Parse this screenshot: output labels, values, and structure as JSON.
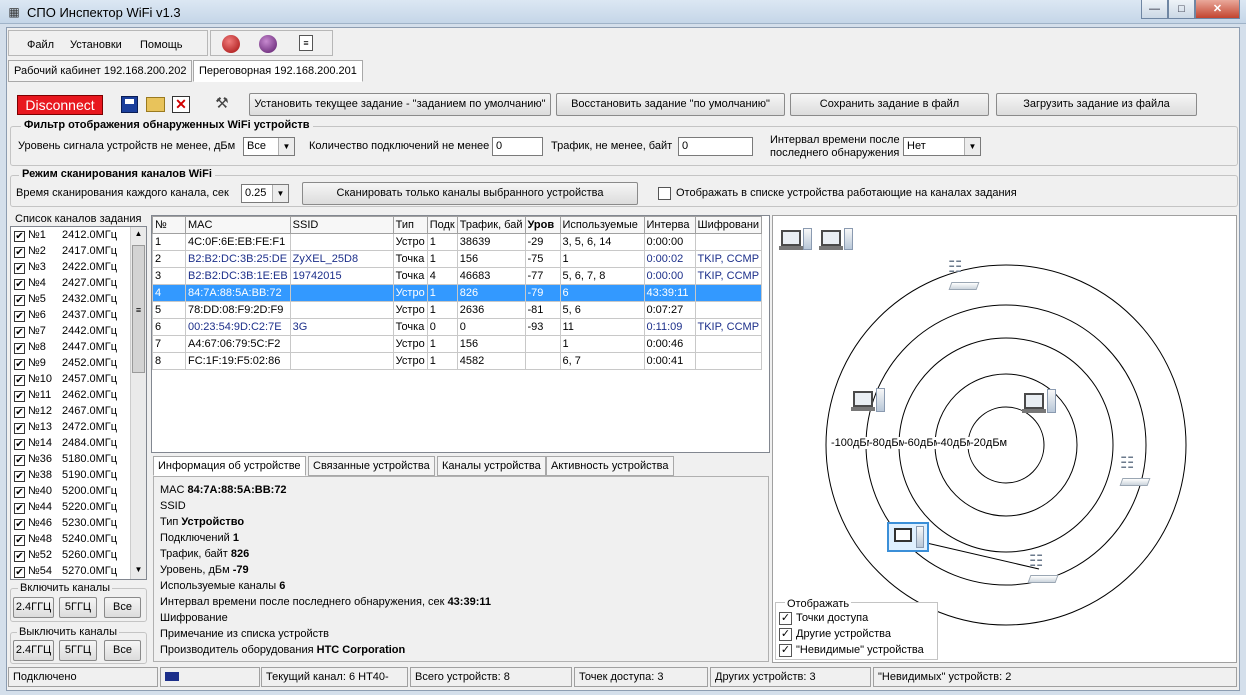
{
  "window": {
    "title": "СПО Инспектор WiFi v1.3"
  },
  "menu": [
    "Файл",
    "Установки",
    "Помощь"
  ],
  "tabs": [
    "Рабочий кабинет 192.168.200.202",
    "Переговорная 192.168.200.201"
  ],
  "toolbar": {
    "disconnect": "Disconnect",
    "set_default": "Установить текущее задание - \"заданием по умолчанию\"",
    "restore_default": "Восстановить задание \"по умолчанию\"",
    "save_to_file": "Сохранить задание в файл",
    "load_from_file": "Загрузить задание из файла"
  },
  "filter": {
    "title": "Фильтр отображения обнаруженных WiFi устройств",
    "signal_label": "Уровень сигнала устройств не менее, дБм",
    "signal_value": "Все",
    "connections_label": "Количество подключений не менее",
    "connections_value": "0",
    "traffic_label": "Трафик, не менее, байт",
    "traffic_value": "0",
    "interval_label_1": "Интервал времени после",
    "interval_label_2": "последнего обнаружения",
    "interval_value": "Нет"
  },
  "scan": {
    "title": "Режим сканирования каналов WiFi",
    "time_label": "Время сканирования каждого канала, сек",
    "time_value": "0.25",
    "scan_selected_button": "Сканировать только каналы выбранного устройства",
    "show_devices_label": "Отображать в списке устройства работающие на каналах задания"
  },
  "channels": {
    "title": "Список каналов задания",
    "items": [
      {
        "label": "№1",
        "freq": "2412.0МГц"
      },
      {
        "label": "№2",
        "freq": "2417.0МГц"
      },
      {
        "label": "№3",
        "freq": "2422.0МГц"
      },
      {
        "label": "№4",
        "freq": "2427.0МГц"
      },
      {
        "label": "№5",
        "freq": "2432.0МГц"
      },
      {
        "label": "№6",
        "freq": "2437.0МГц"
      },
      {
        "label": "№7",
        "freq": "2442.0МГц"
      },
      {
        "label": "№8",
        "freq": "2447.0МГц"
      },
      {
        "label": "№9",
        "freq": "2452.0МГц"
      },
      {
        "label": "№10",
        "freq": "2457.0МГц"
      },
      {
        "label": "№11",
        "freq": "2462.0МГц"
      },
      {
        "label": "№12",
        "freq": "2467.0МГц"
      },
      {
        "label": "№13",
        "freq": "2472.0МГц"
      },
      {
        "label": "№14",
        "freq": "2484.0МГц"
      },
      {
        "label": "№36",
        "freq": "5180.0МГц"
      },
      {
        "label": "№38",
        "freq": "5190.0МГц"
      },
      {
        "label": "№40",
        "freq": "5200.0МГц"
      },
      {
        "label": "№44",
        "freq": "5220.0МГц"
      },
      {
        "label": "№46",
        "freq": "5230.0МГц"
      },
      {
        "label": "№48",
        "freq": "5240.0МГц"
      },
      {
        "label": "№52",
        "freq": "5260.0МГц"
      },
      {
        "label": "№54",
        "freq": "5270.0МГц"
      }
    ],
    "enable_title": "Включить каналы",
    "disable_title": "Выключить каналы",
    "btn_24": "2.4ГГЦ",
    "btn_5": "5ГГЦ",
    "btn_all": "Все"
  },
  "table": {
    "headers": [
      "№",
      "MAC",
      "SSID",
      "Тип",
      "Подк",
      "Трафик, бай",
      "Уров",
      "Используемые",
      "Интерва",
      "Шифровани"
    ],
    "rows": [
      [
        "1",
        "4C:0F:6E:EB:FE:F1",
        "",
        "Устро",
        "1",
        "38639",
        "-29",
        "3, 5, 6, 14",
        "0:00:00",
        ""
      ],
      [
        "2",
        "B2:B2:DC:3B:25:DE",
        "ZyXEL_25D8",
        "Точка",
        "1",
        "156",
        "-75",
        "1",
        "0:00:02",
        "TKIP, CCMP"
      ],
      [
        "3",
        "B2:B2:DC:3B:1E:EB",
        "19742015",
        "Точка",
        "4",
        "46683",
        "-77",
        "5, 6, 7, 8",
        "0:00:00",
        "TKIP, CCMP"
      ],
      [
        "4",
        "84:7A:88:5A:BB:72",
        "",
        "Устро",
        "1",
        "826",
        "-79",
        "6",
        "43:39:11",
        ""
      ],
      [
        "5",
        "78:DD:08:F9:2D:F9",
        "",
        "Устро",
        "1",
        "2636",
        "-81",
        "5, 6",
        "0:07:27",
        ""
      ],
      [
        "6",
        "00:23:54:9D:C2:7E",
        "3G",
        "Точка",
        "0",
        "0",
        "-93",
        "11",
        "0:11:09",
        "TKIP, CCMP"
      ],
      [
        "7",
        "A4:67:06:79:5C:F2",
        "",
        "Устро",
        "1",
        "156",
        "",
        "1",
        "0:00:46",
        ""
      ],
      [
        "8",
        "FC:1F:19:F5:02:86",
        "",
        "Устро",
        "1",
        "4582",
        "",
        "6, 7",
        "0:00:41",
        ""
      ]
    ],
    "selected_index": 3
  },
  "info_tabs": [
    "Информация об устройстве",
    "Связанные устройства",
    "Каналы устройства",
    "Активность устройства"
  ],
  "info": {
    "mac_label": "MAC",
    "mac_value": "84:7A:88:5A:BB:72",
    "ssid_label": "SSID",
    "type_label": "Тип",
    "type_value": "Устройство",
    "conn_label": "Подключений",
    "conn_value": "1",
    "traffic_label": "Трафик, байт",
    "traffic_value": "826",
    "level_label": "Уровень, дБм",
    "level_value": "-79",
    "channels_label": "Используемые каналы",
    "channels_value": "6",
    "interval_label": "Интервал времени после последнего обнаружения, сек",
    "interval_value": "43:39:11",
    "encryption_label": "Шифрование",
    "note_label": "Примечание из списка устройств",
    "vendor_label": "Производитель оборудования",
    "vendor_value": "HTC Corporation"
  },
  "radar": {
    "ring_labels": [
      "-100дБм",
      "-80дБм",
      "-60дБм",
      "-40дБм",
      "-20дБм"
    ],
    "legend_title": "Отображать",
    "legend_items": [
      "Точки доступа",
      "Другие устройства",
      "\"Невидимые\" устройства"
    ]
  },
  "status": {
    "connected": "Подключено",
    "channel": "Текущий канал: 6 HT40-",
    "total": "Всего устройств: 8",
    "aps": "Точек доступа: 3",
    "others": "Других устройств: 3",
    "invisible": "\"Невидимых\" устройств: 2"
  },
  "colors": {
    "selection": "#3399ff",
    "disconnect": "#e8171e",
    "window_frame": "#d4dfeb"
  }
}
